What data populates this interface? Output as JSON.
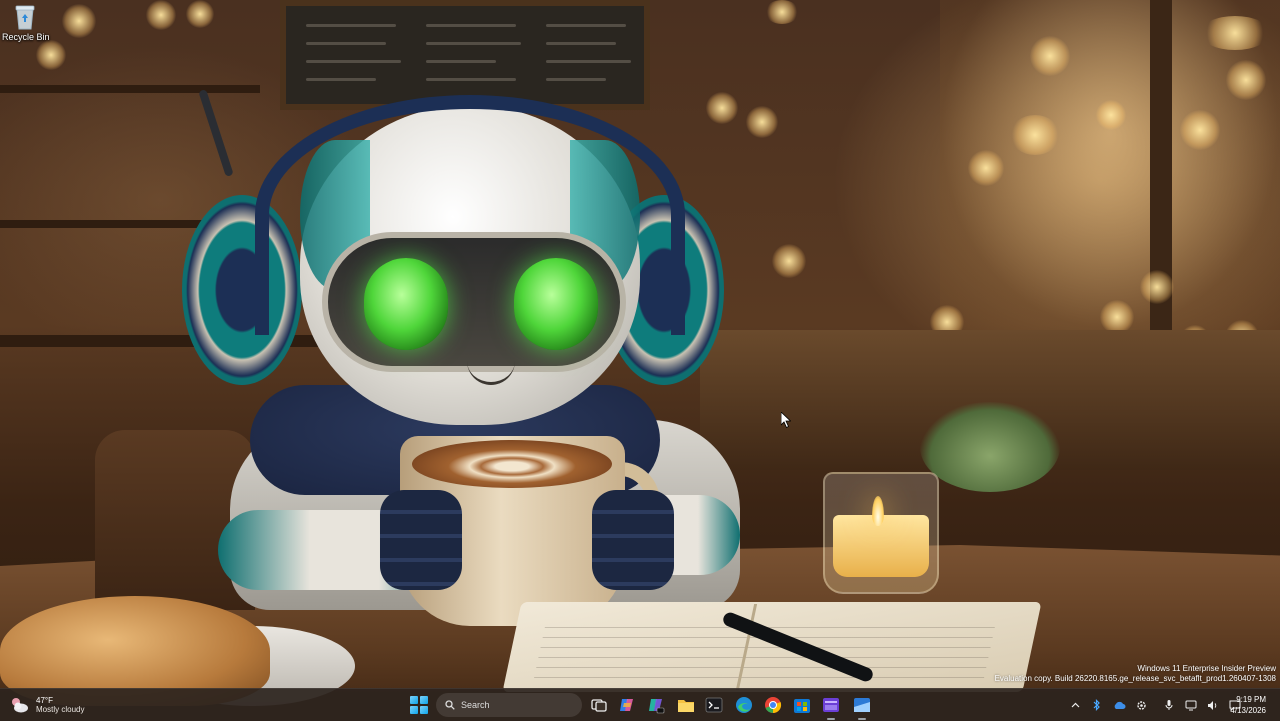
{
  "desktop": {
    "icons": [
      {
        "label": "Recycle Bin",
        "icon": "recycle-bin-icon"
      }
    ]
  },
  "watermark": {
    "line1": "Windows 11 Enterprise Insider Preview",
    "line2": "Evaluation copy. Build 26220.8165.ge_release_svc_betaflt_prod1.260407-1308"
  },
  "taskbar": {
    "weather": {
      "temp": "47°F",
      "condition": "Mostly cloudy",
      "icon": "cloud-moon-icon"
    },
    "search_placeholder": "Search",
    "apps": [
      {
        "name": "task-view",
        "icon": "task-view-icon"
      },
      {
        "name": "copilot",
        "icon": "copilot-icon"
      },
      {
        "name": "copilot-pro",
        "icon": "copilot-pro-icon"
      },
      {
        "name": "file-explorer",
        "icon": "folder-icon"
      },
      {
        "name": "terminal",
        "icon": "terminal-icon"
      },
      {
        "name": "edge",
        "icon": "edge-icon"
      },
      {
        "name": "chrome",
        "icon": "chrome-icon"
      },
      {
        "name": "store",
        "icon": "store-icon"
      },
      {
        "name": "app-purple",
        "icon": "purple-app-icon"
      },
      {
        "name": "app-blue",
        "icon": "blue-app-icon"
      }
    ],
    "tray": [
      "chevron-up-icon",
      "bluetooth-icon",
      "onedrive-icon",
      "settings-icon",
      "microphone-icon",
      "network-icon",
      "speaker-icon",
      "notification-icon"
    ],
    "clock": {
      "time": "9:19 PM",
      "date": "4/13/2026"
    }
  },
  "colors": {
    "accent": "#0ea5e9",
    "taskbar_bg": "#2c241e",
    "eye_green": "#4fd63a"
  }
}
